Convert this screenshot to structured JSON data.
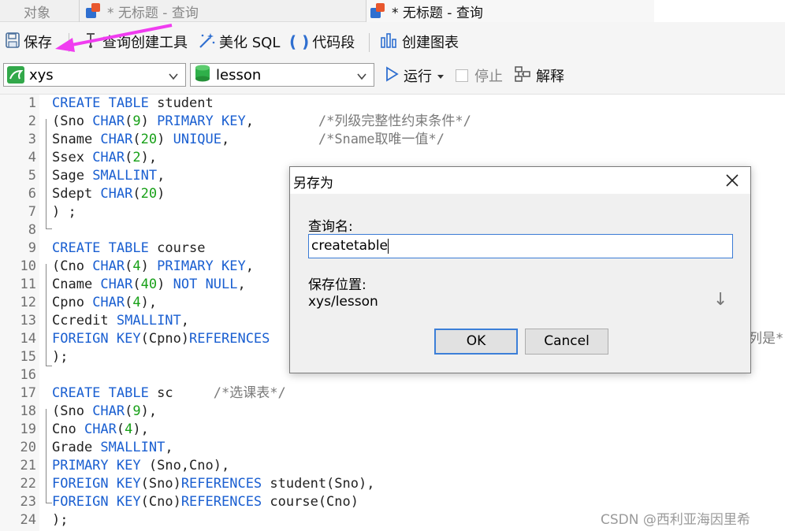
{
  "tabs": [
    {
      "label": "对象",
      "active": false
    },
    {
      "label": "* 无标题 - 查询",
      "active": false
    },
    {
      "label": "* 无标题 - 查询",
      "active": true
    }
  ],
  "toolbar": {
    "save_label": "保存",
    "query_builder_label": "查询创建工具",
    "beautify_label": "美化 SQL",
    "snippet_label": "代码段",
    "chart_label": "创建图表"
  },
  "selectors": {
    "connection": "xys",
    "database": "lesson",
    "run_label": "运行",
    "stop_label": "停止",
    "explain_label": "解释"
  },
  "editor": {
    "line_numbers": [
      "1",
      "2",
      "3",
      "4",
      "5",
      "6",
      "7",
      "8",
      "9",
      "10",
      "11",
      "12",
      "13",
      "14",
      "15",
      "16",
      "17",
      "18",
      "19",
      "20",
      "21",
      "22",
      "23",
      "24"
    ],
    "lines": [
      "CREATE TABLE student",
      "(Sno CHAR(9) PRIMARY KEY,        /*列级完整性约束条件*/",
      "Sname CHAR(20) UNIQUE,           /*Sname取唯一值*/",
      "Ssex CHAR(2),",
      "Sage SMALLINT,",
      "Sdept CHAR(20)",
      ") ;",
      "",
      "CREATE TABLE course",
      "(Cno CHAR(4) PRIMARY KEY,",
      "Cname CHAR(40) NOT NULL,",
      "Cpno CHAR(4),",
      "Ccredit SMALLINT,",
      "FOREIGN KEY(Cpno)REFERENCES",
      ");",
      "",
      "CREATE TABLE sc     /*选课表*/",
      "(Sno CHAR(9),",
      "Cno CHAR(4),",
      "Grade SMALLINT,",
      "PRIMARY KEY (Sno,Cno),",
      "FOREIGN KEY(Sno)REFERENCES student(Sno),",
      "FOREIGN KEY(Cno)REFERENCES course(Cno)",
      ");"
    ],
    "line14_tail": "列是*"
  },
  "dialog": {
    "title": "另存为",
    "name_label": "查询名:",
    "name_value": "createtable",
    "location_label": "保存位置:",
    "location_value": "xys/lesson",
    "ok_label": "OK",
    "cancel_label": "Cancel"
  },
  "watermark": "CSDN @西利亚海因里希",
  "colors": {
    "keyword": "#1a5fd1",
    "number": "#18a018",
    "comment": "#7a7a7a",
    "annotation_arrow": "#f03cf0",
    "focus_border": "#3c7fd8"
  },
  "icons": [
    "save-icon",
    "query-builder-icon",
    "magic-wand-icon",
    "code-snippet-icon",
    "chart-icon",
    "mysql-connection-icon",
    "database-icon",
    "play-icon",
    "dropdown-caret-icon",
    "stop-checkbox-icon",
    "explain-icon",
    "close-icon",
    "down-arrow-icon"
  ]
}
